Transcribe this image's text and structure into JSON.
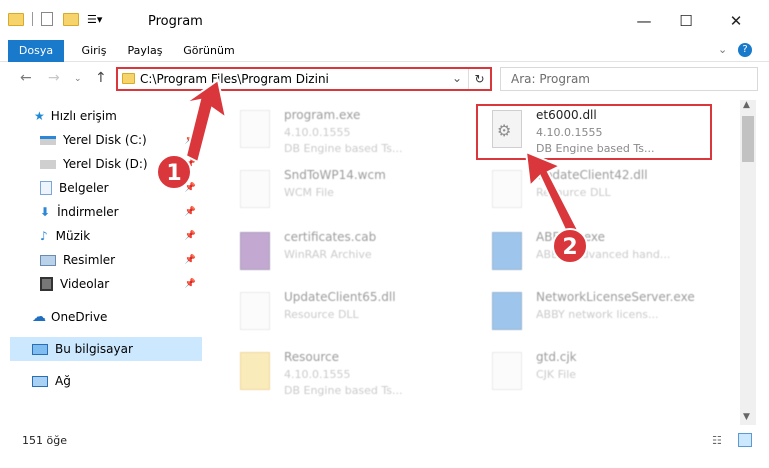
{
  "window": {
    "title": "Program"
  },
  "ribbon": {
    "tabs": [
      "Dosya",
      "Giriş",
      "Paylaş",
      "Görünüm"
    ]
  },
  "address": {
    "path": "C:\\Program Files\\Program Dizini"
  },
  "search": {
    "placeholder": "Ara: Program"
  },
  "sidebar": {
    "items": [
      {
        "label": "Hızlı erişim",
        "icon": "star-icon"
      },
      {
        "label": "Yerel Disk (C:)",
        "icon": "drive-icon"
      },
      {
        "label": "Yerel Disk (D:)",
        "icon": "drive-icon"
      },
      {
        "label": "Belgeler",
        "icon": "documents-icon"
      },
      {
        "label": "İndirmeler",
        "icon": "download-icon"
      },
      {
        "label": "Müzik",
        "icon": "music-icon"
      },
      {
        "label": "Resimler",
        "icon": "pictures-icon"
      },
      {
        "label": "Videolar",
        "icon": "video-icon"
      },
      {
        "label": "OneDrive",
        "icon": "cloud-icon"
      },
      {
        "label": "Bu bilgisayar",
        "icon": "computer-icon"
      },
      {
        "label": "Ağ",
        "icon": "network-icon"
      }
    ]
  },
  "files": [
    {
      "name": "program.exe",
      "line2": "4.10.0.1555",
      "line3": "DB Engine based Ts..."
    },
    {
      "name": "et6000.dll",
      "line2": "4.10.0.1555",
      "line3": "DB Engine based Ts..."
    },
    {
      "name": "SndToWP14.wcm",
      "line2": "WCM File",
      "line3": ""
    },
    {
      "name": "UpdateClient42.dll",
      "line2": "Resource DLL",
      "line3": ""
    },
    {
      "name": "certificates.cab",
      "line2": "WinRAR Archive",
      "line3": ""
    },
    {
      "name": "ABBYY...exe",
      "line2": "ABBYY advanced hand...",
      "line3": ""
    },
    {
      "name": "UpdateClient65.dll",
      "line2": "Resource DLL",
      "line3": ""
    },
    {
      "name": "NetworkLicenseServer.exe",
      "line2": "ABBY network licens...",
      "line3": ""
    },
    {
      "name": "Resource",
      "line2": "4.10.0.1555",
      "line3": "DB Engine based Ts..."
    },
    {
      "name": "gtd.cjk",
      "line2": "CJK File",
      "line3": ""
    }
  ],
  "status": {
    "count": "151 öğe"
  },
  "annotations": [
    "1",
    "2"
  ],
  "colors": {
    "accent": "#1979ca",
    "highlight": "#d9373b"
  }
}
